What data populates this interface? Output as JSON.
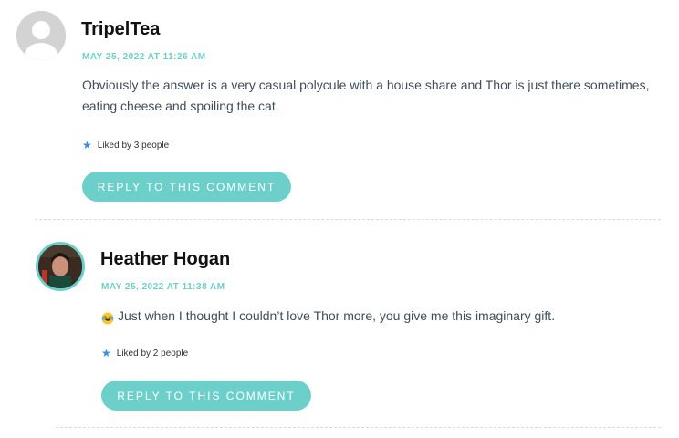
{
  "comments": [
    {
      "author": "TripelTea",
      "date": "MAY 25, 2022 AT 11:26 AM",
      "text": "Obviously the answer is a very casual polycule with a house share and Thor is just there sometimes, eating cheese and spoiling the cat.",
      "likes": "Liked by 3 people",
      "reply_label": "REPLY TO THIS COMMENT",
      "avatar_icon": "default-avatar-icon"
    },
    {
      "author": "Heather Hogan",
      "date": "MAY 25, 2022 AT 11:38 AM",
      "text": "Just when I thought I couldn’t love Thor more, you give me this imaginary gift.",
      "emoji": "face-with-tears-of-joy-icon",
      "likes": "Liked by 2 people",
      "reply_label": "REPLY TO THIS COMMENT",
      "avatar_icon": "user-photo-avatar"
    }
  ],
  "colors": {
    "accent": "#6ccfc9",
    "text": "#404d5b",
    "author": "#111111",
    "like_star": "#3a8fd8",
    "divider": "#dcdcdc"
  }
}
